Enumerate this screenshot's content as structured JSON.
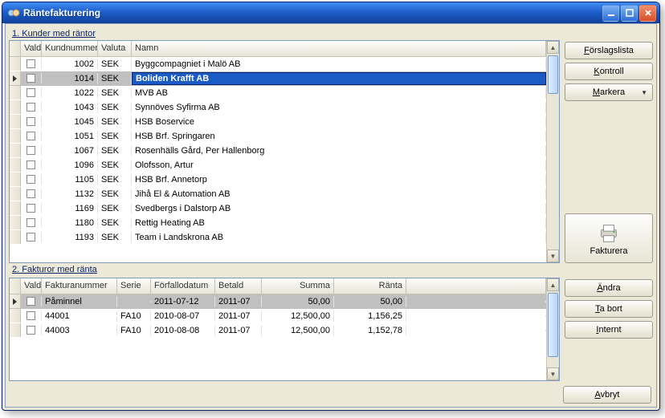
{
  "window": {
    "title": "Räntefakturering"
  },
  "sections": {
    "customers_label": "1. Kunder med räntor",
    "invoices_label": "2. Fakturor med ränta"
  },
  "topButtons": {
    "suggest": "Förslagslista",
    "control": "Kontroll",
    "mark": "Markera",
    "print": "Fakturera"
  },
  "bottomButtons": {
    "edit": "Ändra",
    "remove": "Ta bort",
    "internal": "Internt",
    "cancel": "Avbryt"
  },
  "topGrid": {
    "headers": {
      "vald": "Vald",
      "kundnummer": "Kundnummer",
      "valuta": "Valuta",
      "namn": "Namn"
    },
    "selectedIndex": 1,
    "rows": [
      {
        "num": "1002",
        "valuta": "SEK",
        "namn": "Byggcompagniet i Malö AB"
      },
      {
        "num": "1014",
        "valuta": "SEK",
        "namn": "Boliden Krafft AB"
      },
      {
        "num": "1022",
        "valuta": "SEK",
        "namn": "MVB AB"
      },
      {
        "num": "1043",
        "valuta": "SEK",
        "namn": "Synnöves Syfirma AB"
      },
      {
        "num": "1045",
        "valuta": "SEK",
        "namn": "HSB Boservice"
      },
      {
        "num": "1051",
        "valuta": "SEK",
        "namn": "HSB Brf. Springaren"
      },
      {
        "num": "1067",
        "valuta": "SEK",
        "namn": "Rosenhälls Gård, Per Hallenborg"
      },
      {
        "num": "1096",
        "valuta": "SEK",
        "namn": "Olofsson, Artur"
      },
      {
        "num": "1105",
        "valuta": "SEK",
        "namn": "HSB Brf. Annetorp"
      },
      {
        "num": "1132",
        "valuta": "SEK",
        "namn": "Jihå El & Automation AB"
      },
      {
        "num": "1169",
        "valuta": "SEK",
        "namn": "Svedbergs i Dalstorp AB"
      },
      {
        "num": "1180",
        "valuta": "SEK",
        "namn": "Rettig Heating AB"
      },
      {
        "num": "1193",
        "valuta": "SEK",
        "namn": "Team i Landskrona AB"
      }
    ]
  },
  "bottomGrid": {
    "headers": {
      "vald": "Vald",
      "fakturanummer": "Fakturanummer",
      "serie": "Serie",
      "forfallodatum": "Förfallodatum",
      "betald": "Betald",
      "summa": "Summa",
      "ranta": "Ränta"
    },
    "selectedIndex": 0,
    "rows": [
      {
        "faknr": "Påminnel",
        "serie": "",
        "forfallo": "2011-07-12",
        "betald": "2011-07",
        "summa": "50,00",
        "ranta": "50,00"
      },
      {
        "faknr": "44001",
        "serie": "FA10",
        "forfallo": "2010-08-07",
        "betald": "2011-07",
        "summa": "12,500,00",
        "ranta": "1,156,25"
      },
      {
        "faknr": "44003",
        "serie": "FA10",
        "forfallo": "2010-08-08",
        "betald": "2011-07",
        "summa": "12,500,00",
        "ranta": "1,152,78"
      }
    ]
  }
}
